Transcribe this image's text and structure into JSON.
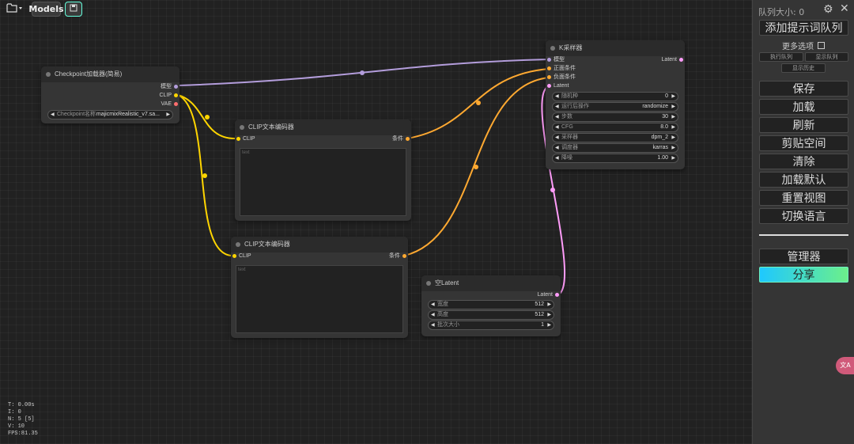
{
  "toolbar": {
    "folder_icon": "folder-icon",
    "models_label": "Models",
    "save_icon": "save-icon"
  },
  "nodes": {
    "checkpoint": {
      "title": "Checkpoint加载器(简易)",
      "outputs": [
        "模型",
        "CLIP",
        "VAE"
      ],
      "widget_label": "Checkpoint名称",
      "widget_value": "majicmixRealistic_v7.sa..."
    },
    "clip1": {
      "title": "CLIP文本编码器",
      "input": "CLIP",
      "output": "条件",
      "placeholder": "text"
    },
    "clip2": {
      "title": "CLIP文本编码器",
      "input": "CLIP",
      "output": "条件",
      "placeholder": "text"
    },
    "ksampler": {
      "title": "K采样器",
      "inputs": [
        "模型",
        "正面条件",
        "负面条件",
        "Latent"
      ],
      "output": "Latent",
      "widgets": [
        {
          "label": "随机种",
          "value": "0"
        },
        {
          "label": "运行后操作",
          "value": "randomize"
        },
        {
          "label": "步数",
          "value": "30"
        },
        {
          "label": "CFG",
          "value": "8.0"
        },
        {
          "label": "采样器",
          "value": "dpm_2"
        },
        {
          "label": "调度器",
          "value": "karras"
        },
        {
          "label": "降噪",
          "value": "1.00"
        }
      ]
    },
    "latent": {
      "title": "空Latent",
      "output": "Latent",
      "widgets": [
        {
          "label": "宽度",
          "value": "512"
        },
        {
          "label": "高度",
          "value": "512"
        },
        {
          "label": "批次大小",
          "value": "1"
        }
      ]
    }
  },
  "stats": [
    "T: 0.00s",
    "I: 0",
    "N: 5 [5]",
    "V: 10",
    "FPS:81.35"
  ],
  "menu": {
    "queue_size": "队列大小: 0",
    "queue_prompt": "添加提示词队列",
    "extra_options": "更多选项",
    "small_buttons": [
      "执行队列",
      "显示队列",
      "显示历史"
    ],
    "buttons": [
      "保存",
      "加载",
      "刷新",
      "剪贴空间",
      "清除",
      "加载默认",
      "重置视图",
      "切换语言"
    ],
    "manager": "管理器",
    "share": "分享"
  },
  "colors": {
    "model_wire": "#b39ddb",
    "clip_wire": "#ffd500",
    "cond_wire": "#ffa931",
    "latent_wire": "#ff9cf9",
    "vae_dot": "#ff6e6e",
    "share_gradient": [
      "#1ec8ff",
      "#6cf08a"
    ]
  },
  "floating_badge": "文A"
}
